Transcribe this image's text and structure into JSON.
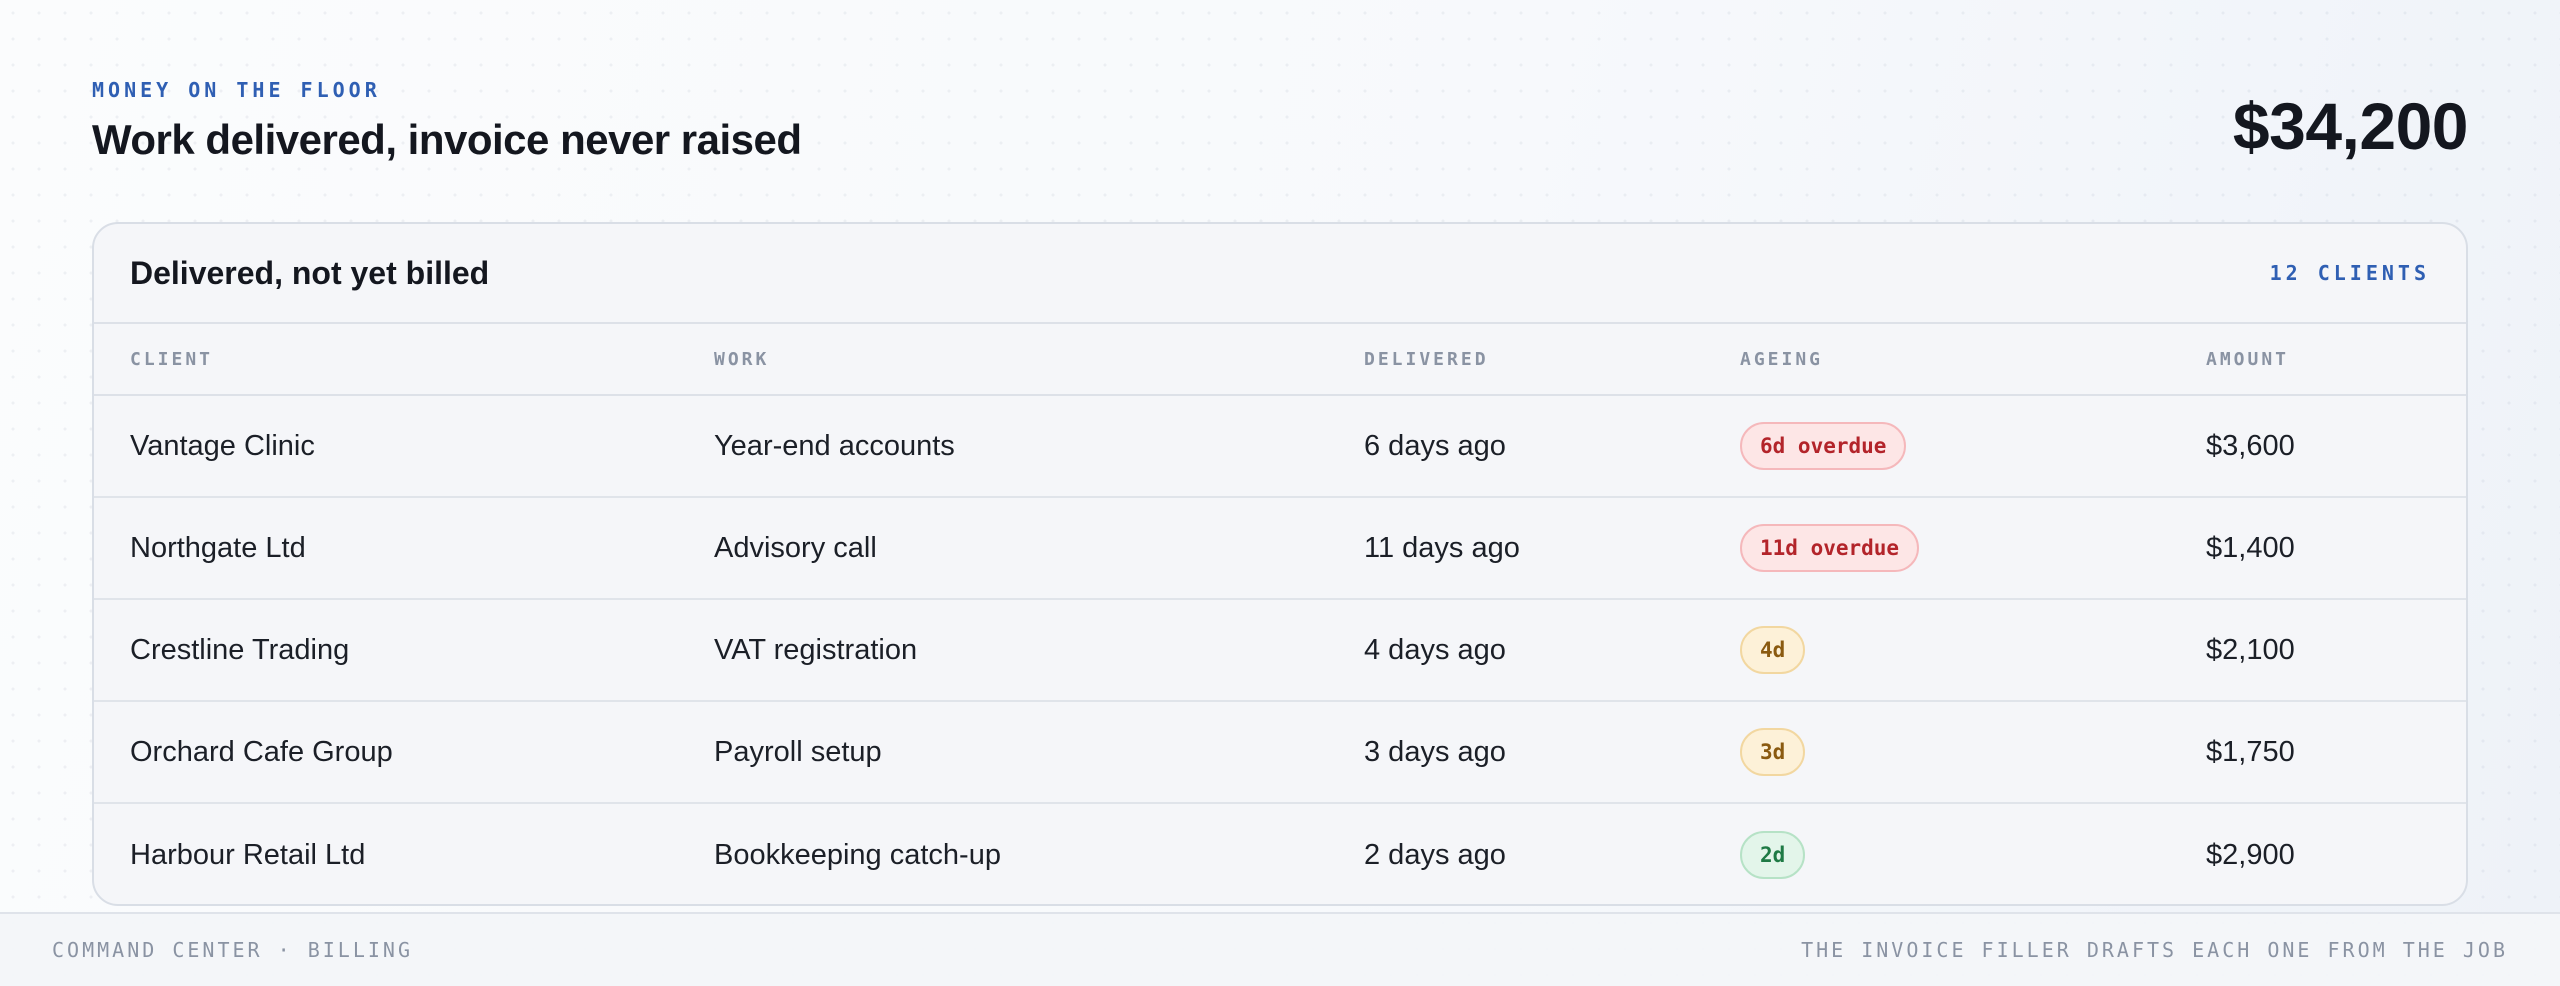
{
  "header": {
    "eyebrow": "MONEY ON THE FLOOR",
    "title": "Work delivered, invoice never raised",
    "total": "$34,200"
  },
  "card": {
    "title": "Delivered, not yet billed",
    "count": "12 CLIENTS"
  },
  "table": {
    "columns": [
      "CLIENT",
      "WORK",
      "DELIVERED",
      "AGEING",
      "AMOUNT"
    ],
    "rows": [
      {
        "client": "Vantage Clinic",
        "work": "Year-end accounts",
        "delivered": "6 days ago",
        "ageing": "6d overdue",
        "status": "overdue",
        "amount": "$3,600"
      },
      {
        "client": "Northgate Ltd",
        "work": "Advisory call",
        "delivered": "11 days ago",
        "ageing": "11d overdue",
        "status": "overdue",
        "amount": "$1,400"
      },
      {
        "client": "Crestline Trading",
        "work": "VAT registration",
        "delivered": "4 days ago",
        "ageing": "4d",
        "status": "warning",
        "amount": "$2,100"
      },
      {
        "client": "Orchard Cafe Group",
        "work": "Payroll setup",
        "delivered": "3 days ago",
        "ageing": "3d",
        "status": "warning",
        "amount": "$1,750"
      },
      {
        "client": "Harbour Retail Ltd",
        "work": "Bookkeeping catch-up",
        "delivered": "2 days ago",
        "ageing": "2d",
        "status": "ok",
        "amount": "$2,900"
      }
    ]
  },
  "colors": {
    "accent": "#2f5fb3",
    "overdue": "#b3242a",
    "warning": "#8a5a10",
    "ok": "#1f7a45"
  },
  "footer": {
    "left": "COMMAND CENTER · BILLING",
    "right": "THE INVOICE FILLER DRAFTS EACH ONE FROM THE JOB"
  }
}
